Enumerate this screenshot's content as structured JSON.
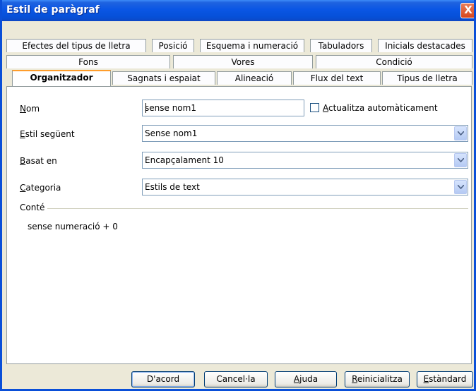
{
  "window": {
    "title": "Estil de paràgraf",
    "close_label": "X"
  },
  "tabs_row1": [
    {
      "label": "Efectes del tipus de lletra"
    },
    {
      "label": "Posició"
    },
    {
      "label": "Esquema i numeració"
    },
    {
      "label": "Tabuladors"
    },
    {
      "label": "Inicials destacades"
    }
  ],
  "tabs_row2": [
    {
      "label": "Fons"
    },
    {
      "label": "Vores"
    },
    {
      "label": "Condició"
    }
  ],
  "tabs_row3": [
    {
      "label": "Organitzador",
      "active": true
    },
    {
      "label": "Sagnats i espaiat"
    },
    {
      "label": "Alineació"
    },
    {
      "label": "Flux del text"
    },
    {
      "label": "Tipus de lletra"
    }
  ],
  "form": {
    "name": {
      "label_u": "N",
      "label_rest": "om",
      "value": "sense nom1"
    },
    "auto_update": {
      "label_u": "A",
      "label_rest": "ctualitza automàticament",
      "checked": false
    },
    "next_style": {
      "label_u": "E",
      "label_rest": "stil següent",
      "value": "Sense nom1"
    },
    "based_on": {
      "label_u": "B",
      "label_rest": "asat en",
      "value": "Encapçalament 10"
    },
    "category": {
      "label_u": "C",
      "label_rest": "ategoria",
      "value": "Estils de text"
    }
  },
  "contains": {
    "title": "Conté",
    "text": "sense numeració + 0"
  },
  "buttons": {
    "ok": "D'acord",
    "cancel": "Cancel·la",
    "help_u": "A",
    "help_rest": "juda",
    "reset_u": "R",
    "reset_rest": "einicialitza",
    "standard_u": "E",
    "standard_rest": "stàndard"
  }
}
